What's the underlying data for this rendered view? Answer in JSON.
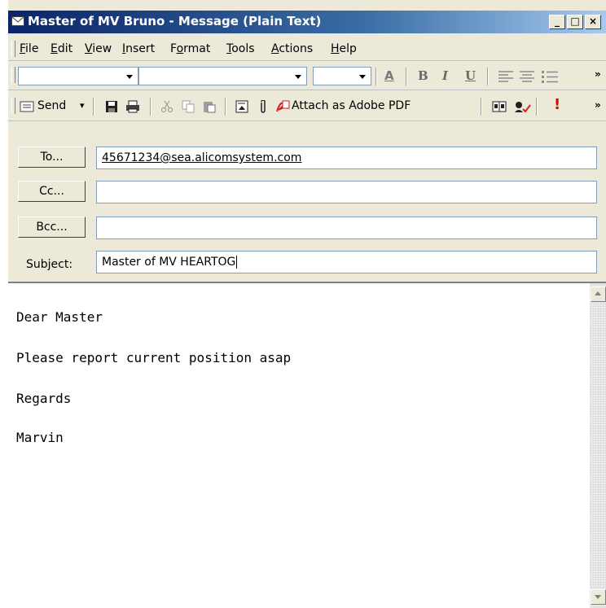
{
  "window": {
    "title": "Master of MV Bruno - Message (Plain Text)",
    "controls": {
      "minimize": "_",
      "maximize": "□",
      "close": "×"
    }
  },
  "menubar": {
    "items": [
      {
        "label": "File",
        "u": "F",
        "rest": "ile"
      },
      {
        "label": "Edit",
        "u": "E",
        "rest": "dit"
      },
      {
        "label": "View",
        "u": "V",
        "rest": "iew"
      },
      {
        "label": "Insert",
        "u": "I",
        "rest": "nsert"
      },
      {
        "label": "Format",
        "pre": "F",
        "u": "o",
        "rest": "rmat"
      },
      {
        "label": "Tools",
        "u": "T",
        "rest": "ools"
      },
      {
        "label": "Actions",
        "u": "A",
        "rest": "ctions"
      },
      {
        "label": "Help",
        "u": "H",
        "rest": "elp"
      }
    ]
  },
  "format_toolbar": {
    "font_color_glyph": "A",
    "bold": "B",
    "italic": "I",
    "underline": "U",
    "overflow": "»"
  },
  "standard_toolbar": {
    "send_label": "Send",
    "attach_pdf_label": "Attach as Adobe PDF",
    "importance_glyph": "!",
    "overflow": "»"
  },
  "header": {
    "to_button": "To...",
    "cc_button": "Cc...",
    "bcc_button": "Bcc...",
    "subject_label": "Subject:",
    "to_value": "45671234@sea.alicomsystem.com",
    "cc_value": "",
    "bcc_value": "",
    "subject_value": "Master of MV HEARTOG"
  },
  "body": {
    "lines": [
      "Dear Master",
      "Please report current position asap",
      "Regards",
      "Marvin"
    ]
  },
  "colors": {
    "titlebar_start": "#0a246a",
    "titlebar_end": "#a6caf0",
    "chrome": "#ece9d8",
    "importance_red": "#e00000",
    "pdf_red": "#d42020"
  }
}
